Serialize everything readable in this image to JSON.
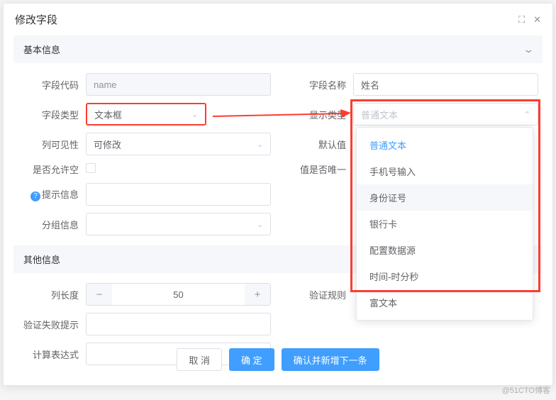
{
  "modal": {
    "title": "修改字段"
  },
  "sections": {
    "basic": "基本信息",
    "other": "其他信息"
  },
  "labels": {
    "fieldCode": "字段代码",
    "fieldName": "字段名称",
    "fieldType": "字段类型",
    "displayType": "显示类型",
    "colVisible": "列可见性",
    "defaultValue": "默认值",
    "allowEmpty": "是否允许空",
    "valueUnique": "值是否唯一",
    "hint": "提示信息",
    "group": "分组信息",
    "colLength": "列长度",
    "validateRule": "验证规则",
    "validateFailMsg": "验证失败提示",
    "calcExpr": "计算表达式"
  },
  "values": {
    "fieldCode": "name",
    "fieldName": "姓名",
    "fieldType": "文本框",
    "displayTypePlaceholder": "普通文本",
    "colVisible": "可修改",
    "colLength": "50"
  },
  "dropdown": {
    "options": [
      "普通文本",
      "手机号输入",
      "身份证号",
      "银行卡",
      "配置数据源",
      "时间-时分秒",
      "富文本"
    ],
    "selectedIndex": 0,
    "hoverIndex": 2
  },
  "buttons": {
    "cancel": "取 消",
    "confirm": "确 定",
    "confirmNext": "确认并新增下一条"
  },
  "watermark": "@51CTO博客"
}
